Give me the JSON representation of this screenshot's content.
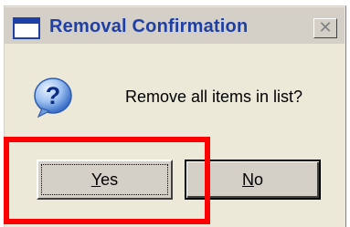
{
  "window": {
    "title": "Removal Confirmation",
    "close_glyph": "✕",
    "icon": "app-window-icon"
  },
  "dialog": {
    "icon": "question-icon",
    "message": "Remove all items in list?"
  },
  "buttons": {
    "yes": {
      "mnemonic": "Y",
      "rest": "es"
    },
    "no": {
      "mnemonic": "N",
      "rest": "o"
    }
  },
  "annotation": {
    "highlight_color": "#ff0000",
    "highlighted": "yes-button"
  },
  "colors": {
    "title_text": "#1e3fa6",
    "dialog_background": "#ece9d8"
  }
}
